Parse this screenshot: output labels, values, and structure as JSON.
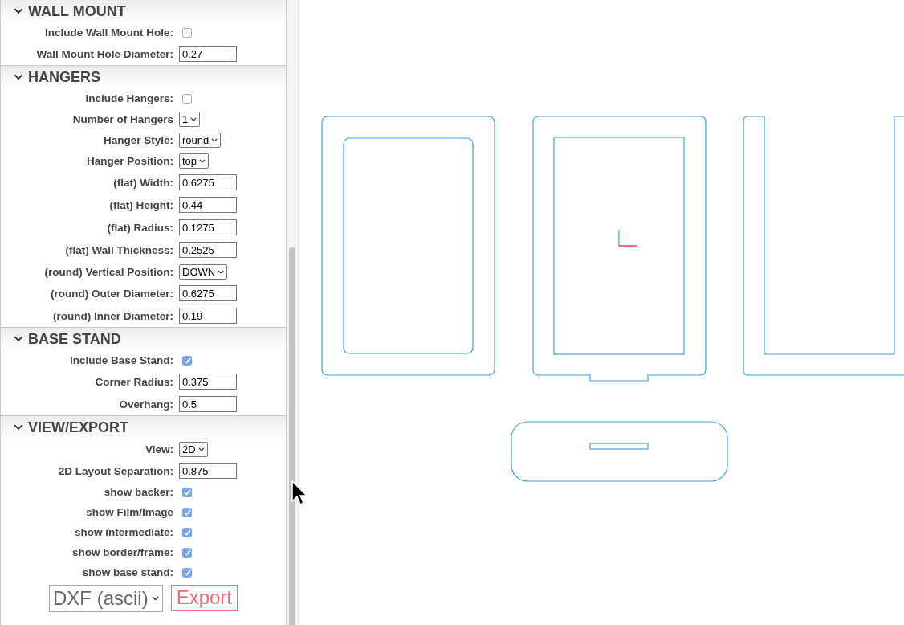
{
  "sections": [
    {
      "title": "WALL MOUNT",
      "expanded": true,
      "fields": [
        {
          "kind": "checkbox",
          "label": "Include Wall Mount Hole:",
          "checked": false
        },
        {
          "kind": "input",
          "label": "Wall Mount Hole Diameter:",
          "value": "0.27"
        }
      ]
    },
    {
      "title": "HANGERS",
      "expanded": true,
      "fields": [
        {
          "kind": "checkbox",
          "label": "Include Hangers:",
          "checked": false
        },
        {
          "kind": "select",
          "label": "Number of Hangers",
          "value": "1"
        },
        {
          "kind": "select",
          "label": "Hanger Style:",
          "value": "round"
        },
        {
          "kind": "select",
          "label": "Hanger Position:",
          "value": "top"
        },
        {
          "kind": "input",
          "label": "(flat) Width:",
          "value": "0.6275"
        },
        {
          "kind": "input",
          "label": "(flat) Height:",
          "value": "0.44"
        },
        {
          "kind": "input",
          "label": "(flat) Radius:",
          "value": "0.1275"
        },
        {
          "kind": "input",
          "label": "(flat) Wall Thickness:",
          "value": "0.2525"
        },
        {
          "kind": "select",
          "label": "(round) Vertical Position:",
          "value": "DOWN"
        },
        {
          "kind": "input",
          "label": "(round) Outer Diameter:",
          "value": "0.6275"
        },
        {
          "kind": "input",
          "label": "(round) Inner Diameter:",
          "value": "0.19"
        }
      ]
    },
    {
      "title": "BASE STAND",
      "expanded": true,
      "fields": [
        {
          "kind": "checkbox",
          "label": "Include Base Stand:",
          "checked": true
        },
        {
          "kind": "input",
          "label": "Corner Radius:",
          "value": "0.375"
        },
        {
          "kind": "input",
          "label": "Overhang:",
          "value": "0.5"
        }
      ]
    },
    {
      "title": "VIEW/EXPORT",
      "expanded": true,
      "fields": [
        {
          "kind": "select",
          "label": "View:",
          "value": "2D"
        },
        {
          "kind": "input",
          "label": "2D Layout Separation:",
          "value": "0.875"
        },
        {
          "kind": "checkbox",
          "label": "show backer:",
          "checked": true
        },
        {
          "kind": "checkbox",
          "label": "show Film/Image",
          "checked": true
        },
        {
          "kind": "checkbox",
          "label": "show intermediate:",
          "checked": true
        },
        {
          "kind": "checkbox",
          "label": "show border/frame:",
          "checked": true
        },
        {
          "kind": "checkbox",
          "label": "show base stand:",
          "checked": true
        }
      ]
    }
  ],
  "export": {
    "format": "DXF (ascii)",
    "button": "Export"
  }
}
